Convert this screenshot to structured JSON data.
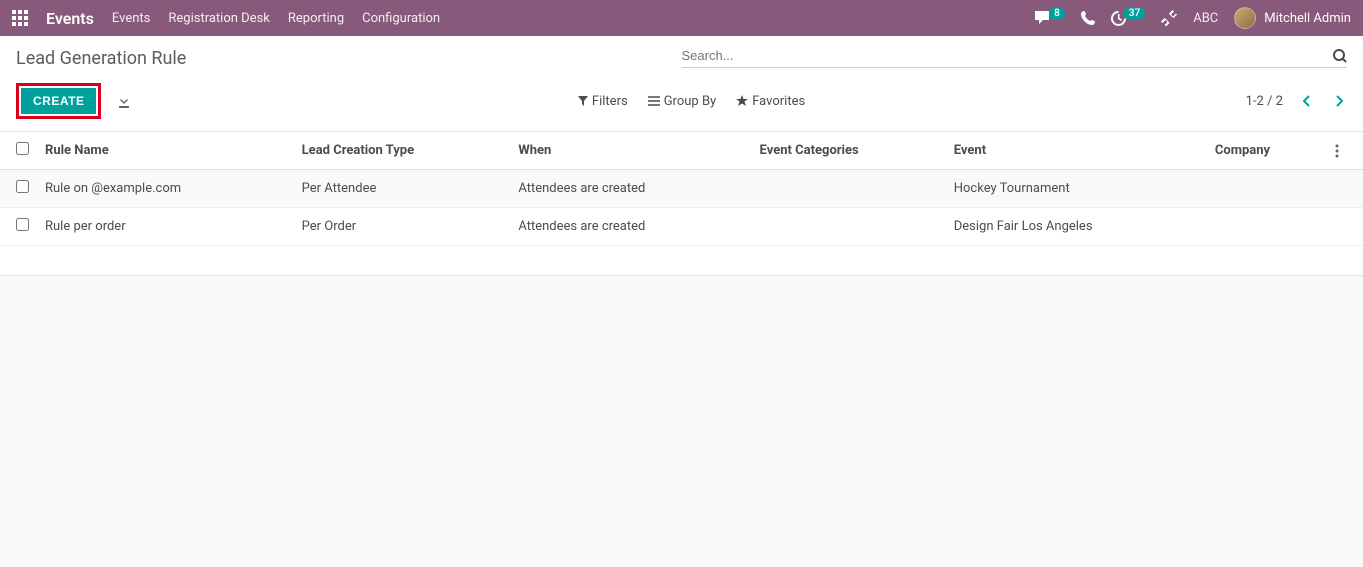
{
  "navbar": {
    "brand": "Events",
    "links": [
      "Events",
      "Registration Desk",
      "Reporting",
      "Configuration"
    ],
    "messages_badge": "8",
    "activities_badge": "37",
    "company": "ABC",
    "user": "Mitchell Admin"
  },
  "breadcrumb": "Lead Generation Rule",
  "search": {
    "placeholder": "Search..."
  },
  "buttons": {
    "create": "CREATE",
    "filters": "Filters",
    "group_by": "Group By",
    "favorites": "Favorites"
  },
  "pager": "1-2 / 2",
  "table": {
    "headers": [
      "Rule Name",
      "Lead Creation Type",
      "When",
      "Event Categories",
      "Event",
      "Company"
    ],
    "rows": [
      {
        "name": "Rule on @example.com",
        "type": "Per Attendee",
        "when": "Attendees are created",
        "categories": "",
        "event": "Hockey Tournament",
        "company": ""
      },
      {
        "name": "Rule per order",
        "type": "Per Order",
        "when": "Attendees are created",
        "categories": "",
        "event": "Design Fair Los Angeles",
        "company": ""
      }
    ]
  }
}
